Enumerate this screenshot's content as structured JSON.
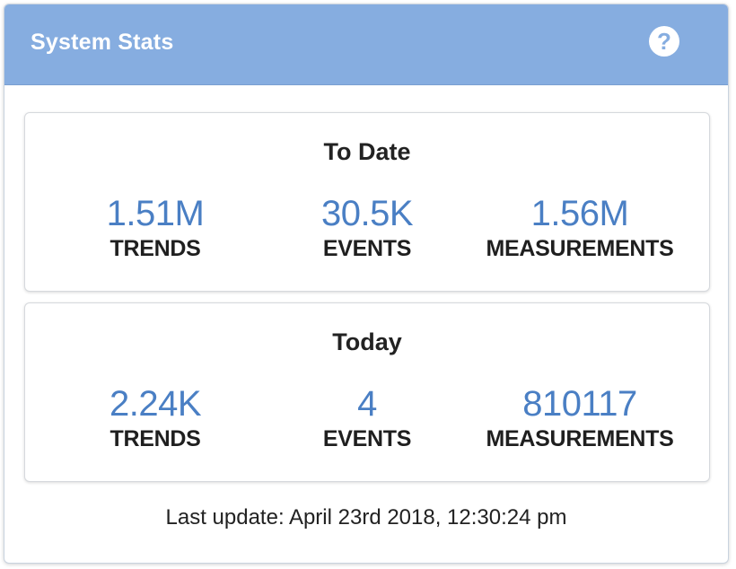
{
  "header": {
    "title": "System Stats",
    "help_icon": "question-circle-icon"
  },
  "to_date": {
    "title": "To Date",
    "stats": [
      {
        "value": "1.51M",
        "label": "TRENDS"
      },
      {
        "value": "30.5K",
        "label": "EVENTS"
      },
      {
        "value": "1.56M",
        "label": "MEASUREMENTS"
      }
    ]
  },
  "today": {
    "title": "Today",
    "stats": [
      {
        "value": "2.24K",
        "label": "TRENDS"
      },
      {
        "value": "4",
        "label": "EVENTS"
      },
      {
        "value": "810117",
        "label": "MEASUREMENTS"
      }
    ]
  },
  "footer": {
    "last_update": "Last update: April 23rd 2018, 12:30:24 pm"
  },
  "colors": {
    "header_bg": "#86ade0",
    "value_text": "#4a7fc4"
  }
}
